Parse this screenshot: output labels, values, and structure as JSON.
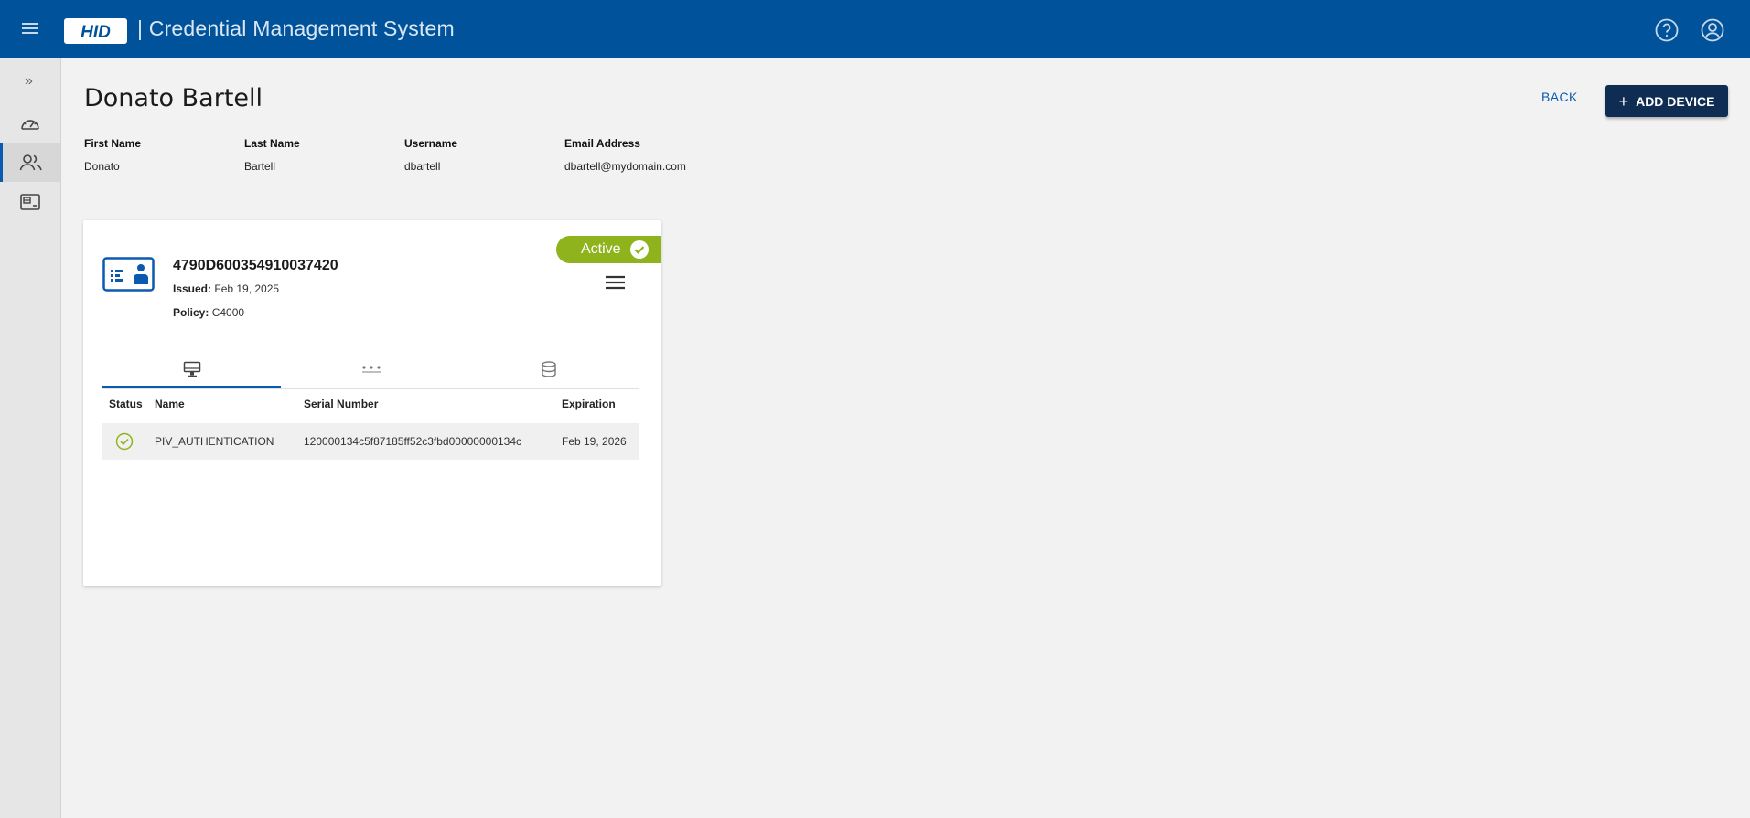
{
  "header": {
    "logo_text": "HID",
    "app_title": "| Credential Management System",
    "icons": [
      "menu-icon",
      "help-icon",
      "account-icon"
    ],
    "brand_color": "#00539b"
  },
  "sidebar": {
    "items": [
      {
        "name": "expand",
        "icon": "double-chevron-right-icon",
        "glyph": "»"
      },
      {
        "name": "dashboard",
        "icon": "speedometer-icon"
      },
      {
        "name": "users",
        "icon": "users-icon",
        "active": true
      },
      {
        "name": "credentials",
        "icon": "card-terminal-icon"
      }
    ]
  },
  "page": {
    "title": "Donato Bartell",
    "back_label": "BACK",
    "add_label": "ADD DEVICE",
    "add_plus": "+"
  },
  "user": {
    "first_name_label": "First Name",
    "first_name": "Donato",
    "last_name_label": "Last Name",
    "last_name": "Bartell",
    "username_label": "Username",
    "username": "dbartell",
    "email_label": "Email Address",
    "email": "dbartell@mydomain.com"
  },
  "device": {
    "status": "Active",
    "status_color": "#8fb31d",
    "id": "4790D600354910037420",
    "issued_label": "Issued:",
    "issued": "Feb 19, 2025",
    "policy_label": "Policy:",
    "policy": "C4000",
    "tabs": [
      {
        "icon": "certificate-terminal-icon",
        "active": true
      },
      {
        "icon": "password-dots-icon"
      },
      {
        "icon": "database-icon"
      }
    ],
    "table": {
      "headers": [
        "Status",
        "Name",
        "Serial Number",
        "Expiration"
      ],
      "rows": [
        {
          "status_icon": "check-circle-icon",
          "name": "PIV_AUTHENTICATION",
          "serial": "120000134c5f87185ff52c3fbd00000000134c",
          "expiration": "Feb 19, 2026"
        }
      ]
    }
  }
}
